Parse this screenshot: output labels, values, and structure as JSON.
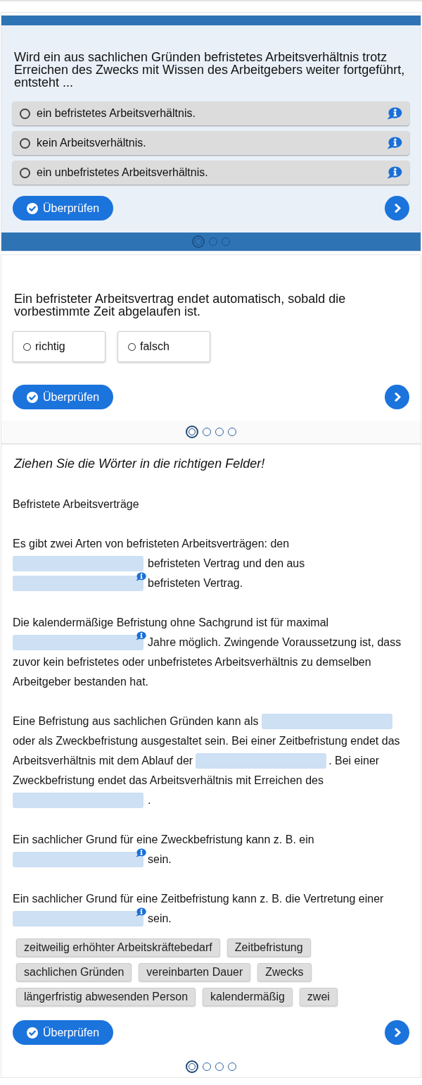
{
  "quizzes": [
    {
      "kind": "multiple_choice",
      "question": "Wird ein aus sachlichen Gründen befristetes Arbeitsverhältnis trotz Erreichen des Zwecks mit Wissen des Arbeitgebers weiter fortgeführt, entsteht ...",
      "options": [
        {
          "label": "ein befristetes Arbeitsverhältnis.",
          "selected": false,
          "info": true
        },
        {
          "label": "kein Arbeitsverhältnis.",
          "selected": false,
          "info": true
        },
        {
          "label": "ein unbefristetes Arbeitsverhältnis.",
          "selected": false,
          "info": true
        }
      ],
      "check_button": "Überprüfen",
      "pages": [
        {
          "selected": true
        },
        {
          "selected": false
        },
        {
          "selected": false
        }
      ]
    },
    {
      "kind": "true_false",
      "question": "Ein befristeter Arbeitsvertrag endet automatisch, sobald die vorbestimmte Zeit abgelaufen ist.",
      "options": [
        {
          "label": "richtig",
          "selected": false
        },
        {
          "label": "falsch",
          "selected": false
        }
      ],
      "check_button": "Überprüfen",
      "pages": [
        {
          "selected": true
        },
        {
          "selected": false
        },
        {
          "selected": false
        },
        {
          "selected": false
        }
      ]
    },
    {
      "kind": "drag_words",
      "instruction": "Ziehen Sie die Wörter in die richtigen Felder!",
      "heading": "Befristete Arbeitsverträge",
      "paragraphs": [
        {
          "lines": [
            [
              {
                "kind": "text",
                "text": "Es gibt zwei Arten von befristeten Arbeitsverträgen: den"
              }
            ],
            [
              {
                "kind": "blank",
                "info": false
              },
              {
                "kind": "text",
                "text": "befristeten Vertrag und den aus"
              }
            ],
            [
              {
                "kind": "blank",
                "info": true
              },
              {
                "kind": "text",
                "text": "befristeten Vertrag."
              }
            ]
          ]
        },
        {
          "lines": [
            [
              {
                "kind": "text",
                "text": "Die kalendermäßige Befristung ohne Sachgrund ist für maximal"
              }
            ],
            [
              {
                "kind": "blank",
                "info": true
              },
              {
                "kind": "text",
                "text": "Jahre möglich. Zwingende Voraussetzung ist, dass"
              }
            ],
            [
              {
                "kind": "text",
                "text": "zuvor kein befristetes oder unbefristetes Arbeitsverhältnis zu demselben"
              }
            ],
            [
              {
                "kind": "text",
                "text": "Arbeitgeber bestanden hat."
              }
            ]
          ]
        },
        {
          "lines": [
            [
              {
                "kind": "text",
                "text": "Eine Befristung aus sachlichen Gründen kann als"
              },
              {
                "kind": "blank",
                "info": false
              }
            ],
            [
              {
                "kind": "text",
                "text": "oder als Zweckbefristung ausgestaltet sein. Bei einer Zeitbefristung endet das"
              }
            ],
            [
              {
                "kind": "text",
                "text": "Arbeitsverhältnis mit dem Ablauf der"
              },
              {
                "kind": "blank",
                "info": false
              },
              {
                "kind": "text",
                "text": ". Bei einer"
              }
            ],
            [
              {
                "kind": "text",
                "text": "Zweckbefristung endet das Arbeitsverhältnis mit Erreichen des"
              }
            ],
            [
              {
                "kind": "blank",
                "info": false
              },
              {
                "kind": "text",
                "text": "."
              }
            ]
          ]
        },
        {
          "lines": [
            [
              {
                "kind": "text",
                "text": "Ein sachlicher Grund für eine Zweckbefristung kann z. B. ein"
              }
            ],
            [
              {
                "kind": "blank",
                "info": true
              },
              {
                "kind": "text",
                "text": "sein."
              }
            ]
          ]
        },
        {
          "lines": [
            [
              {
                "kind": "text",
                "text": "Ein sachlicher Grund für eine Zeitbefristung kann z. B. die Vertretung einer"
              }
            ],
            [
              {
                "kind": "blank",
                "info": true
              },
              {
                "kind": "text",
                "text": "sein."
              }
            ]
          ]
        }
      ],
      "words": [
        "zeitweilig erhöhter Arbeitskräftebedarf",
        "Zeitbefristung",
        "sachlichen Gründen",
        "vereinbarten Dauer",
        "Zwecks",
        "längerfristig abwesenden Person",
        "kalendermäßig",
        "zwei"
      ],
      "check_button": "Überprüfen",
      "pages": [
        {
          "selected": true
        },
        {
          "selected": false
        },
        {
          "selected": false
        },
        {
          "selected": false
        }
      ]
    }
  ]
}
